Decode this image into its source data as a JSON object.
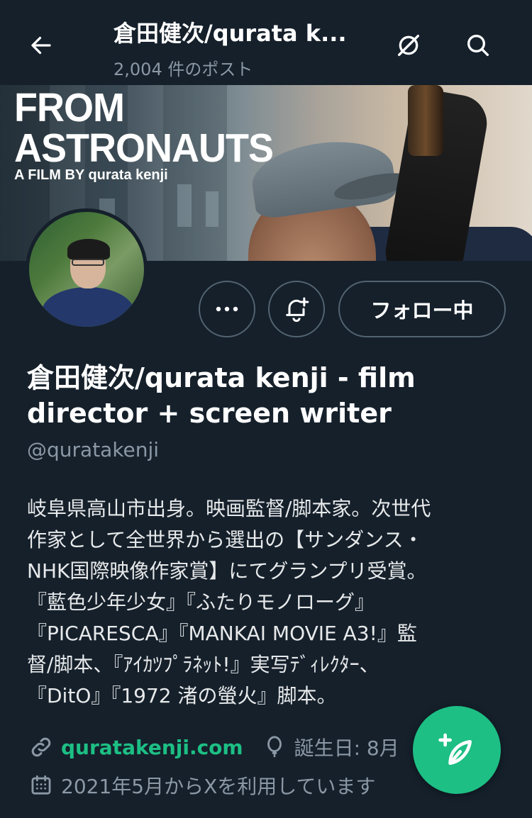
{
  "header": {
    "title": "倉田健次/qurata k...",
    "post_count": "2,004 件のポスト"
  },
  "banner": {
    "line1": "FROM",
    "line2": "ASTRONAUTS",
    "line3": "A FILM BY qurata kenji"
  },
  "actions": {
    "more_label": "•••",
    "follow_label": "フォロー中"
  },
  "profile": {
    "display_name": "倉田健次/qurata kenji - film director + screen writer",
    "handle": "@quratakenji",
    "bio": "岐阜県高山市出身。映画監督/脚本家。次世代\n作家として全世界から選出の【サンダンス・\nNHK国際映像作家賞】にてグランプリ受賞。\n『藍色少年少女』『ふたりモノローグ』\n『PICARESCA』『MANKAI MOVIE A3!』監\n督/脚本、『ｱｲｶﾂﾌﾟﾗﾈｯﾄ!』実写ﾃﾞｨﾚｸﾀｰ、\n『DitO』『1972 渚の螢火』脚本。",
    "website": "quratakenji.com",
    "birthday": "誕生日: 8月",
    "joined": "2021年5月からXを利用しています"
  },
  "colors": {
    "background": "#15202b",
    "accent": "#1dbf84",
    "muted": "#8b98a5"
  },
  "icons": {
    "back": "back-arrow-icon",
    "hide": "eye-slash-icon",
    "search": "search-icon",
    "notify": "bell-plus-icon",
    "link": "link-icon",
    "birthday": "balloon-icon",
    "calendar": "calendar-icon",
    "compose": "compose-icon"
  }
}
